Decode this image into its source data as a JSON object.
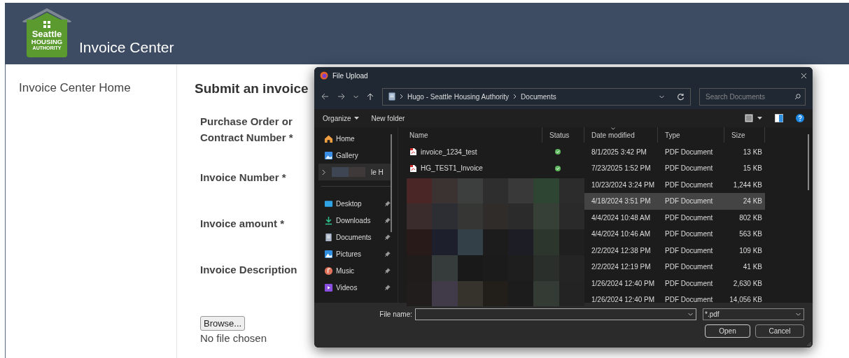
{
  "header": {
    "logo_lines": [
      "Seattle",
      "HOUSING",
      "AUTHORITY"
    ],
    "title": "Invoice Center"
  },
  "sidebar": {
    "items": [
      {
        "label": "Invoice Center Home"
      }
    ]
  },
  "form": {
    "heading": "Submit an invoice",
    "fields": [
      {
        "label": "Purchase Order or Contract Number *"
      },
      {
        "label": "Invoice Number *"
      },
      {
        "label": "Invoice amount *"
      },
      {
        "label": "Invoice Description"
      }
    ],
    "browse_button": "Browse...",
    "file_status": "No file chosen"
  },
  "dialog": {
    "title": "File Upload",
    "breadcrumb": [
      "Hugo - Seattle Housing Authority",
      "Documents"
    ],
    "search": {
      "placeholder": "Search Documents"
    },
    "toolbar": {
      "organize": "Organize",
      "new_folder": "New folder"
    },
    "nav": [
      {
        "kind": "home",
        "label": "Home",
        "pinned": false,
        "selected": false
      },
      {
        "kind": "gallery",
        "label": "Gallery",
        "pinned": false,
        "selected": false
      },
      {
        "kind": "redacted",
        "label": "le H",
        "pinned": false,
        "selected": true
      },
      {
        "kind": "desktop",
        "label": "Desktop",
        "pinned": true,
        "selected": false
      },
      {
        "kind": "downloads",
        "label": "Downloads",
        "pinned": true,
        "selected": false
      },
      {
        "kind": "documents",
        "label": "Documents",
        "pinned": true,
        "selected": false
      },
      {
        "kind": "pictures",
        "label": "Pictures",
        "pinned": true,
        "selected": false
      },
      {
        "kind": "music",
        "label": "Music",
        "pinned": true,
        "selected": false
      },
      {
        "kind": "videos",
        "label": "Videos",
        "pinned": true,
        "selected": false
      }
    ],
    "columns": [
      "Name",
      "Status",
      "Date modified",
      "Type",
      "Size"
    ],
    "files": [
      {
        "name": "invoice_1234_test",
        "synced": true,
        "date": "8/1/2025 3:42 PM",
        "type": "PDF Document",
        "size": "13 KB",
        "selected": false
      },
      {
        "name": "HG_TEST1_Invoice",
        "synced": true,
        "date": "7/23/2025 1:52 PM",
        "type": "PDF Document",
        "size": "15 KB",
        "selected": false
      },
      {
        "date": "10/23/2024 3:24 PM",
        "type": "PDF Document",
        "size": "1,244 KB",
        "selected": false
      },
      {
        "date": "4/18/2024 3:51 PM",
        "type": "PDF Document",
        "size": "24 KB",
        "selected": true
      },
      {
        "date": "4/4/2024 10:48 AM",
        "type": "PDF Document",
        "size": "802 KB",
        "selected": false
      },
      {
        "date": "4/4/2024 10:46 AM",
        "type": "PDF Document",
        "size": "563 KB",
        "selected": false
      },
      {
        "date": "2/2/2024 12:38 PM",
        "type": "PDF Document",
        "size": "109 KB",
        "selected": false
      },
      {
        "date": "2/2/2024 12:19 PM",
        "type": "PDF Document",
        "size": "41 KB",
        "selected": false
      },
      {
        "date": "1/26/2024 12:40 PM",
        "type": "PDF Document",
        "size": "2,630 KB",
        "selected": false
      },
      {
        "date": "1/26/2024 12:40 PM",
        "type": "PDF Document",
        "size": "14,056 KB",
        "selected": false
      }
    ],
    "file_name_label": "File name:",
    "filter": "*.pdf",
    "buttons": [
      "Open",
      "Cancel"
    ]
  }
}
